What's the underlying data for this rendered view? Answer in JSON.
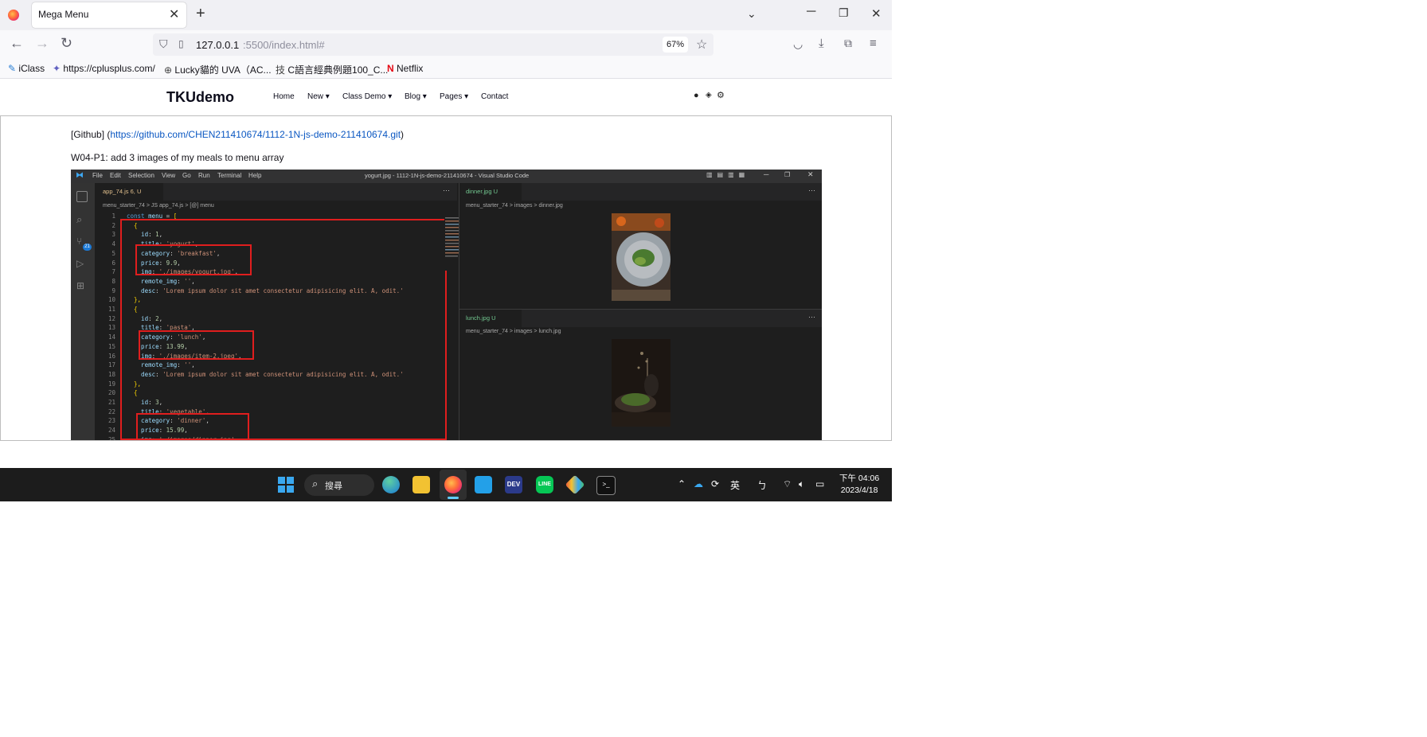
{
  "browser": {
    "tab_title": "Mega Menu",
    "tab_close": "✕",
    "new_tab": "+",
    "url_host": "127.0.0.1",
    "url_path": ":5500/index.html#",
    "zoom": "67%",
    "bookmarks": [
      "iClass",
      "https://cplusplus.com/",
      "Lucky貓的 UVA（AC...",
      "C語言經典例題100_C...",
      "Netflix"
    ]
  },
  "site": {
    "brand": "TKUdemo",
    "menu": [
      "Home",
      "New",
      "Class Demo",
      "Blog",
      "Pages",
      "Contact"
    ],
    "github_prefix": "[Github] (",
    "github_url": "https://github.com/CHEN211410674/1112-1N-js-demo-211410674.git",
    "github_suffix": ")",
    "assignment": "W04-P1: add 3 images of my meals to menu array"
  },
  "vscode": {
    "menus": [
      "File",
      "Edit",
      "Selection",
      "View",
      "Go",
      "Run",
      "Terminal",
      "Help"
    ],
    "window_title": "yogurt.jpg - 1112-1N-js-demo-211410674 - Visual Studio Code",
    "editor_tab": "app_74.js 6, U",
    "editor_breadcrumb": "menu_starter_74  >  JS app_74.js  >  [@] menu",
    "code_lines": [
      "const menu = [",
      "  {",
      "    id: 1,",
      "    title: 'yogurt',",
      "    category: 'breakfast',",
      "    price: 9.9,",
      "    img: './images/yogurt.jpg',",
      "    remote_img: '',",
      "    desc: 'Lorem ipsum dolor sit amet consectetur adipisicing elit. A, odit.'",
      "  },",
      "  {",
      "    id: 2,",
      "    title: 'pasta',",
      "    category: 'lunch',",
      "    price: 13.99,",
      "    img: './images/item-2.jpeg',",
      "    remote_img: '',",
      "    desc: 'Lorem ipsum dolor sit amet consectetur adipisicing elit. A, odit.'",
      "  },",
      "  {",
      "    id: 3,",
      "    title: 'vegetable',",
      "    category: 'dinner',",
      "    price: 15.99,",
      "    img: './images/dinner.jpg',"
    ],
    "pane_top_tab": "dinner.jpg  U",
    "pane_top_crumb": "menu_starter_74  >  images  >  dinner.jpg",
    "pane_bottom_tab": "lunch.jpg  U",
    "pane_bottom_crumb": "menu_starter_74  >  images  >  lunch.jpg"
  },
  "taskbar": {
    "search": "搜尋",
    "ime": "英",
    "time": "下午 04:06",
    "date": "2023/4/18"
  },
  "colors": {
    "accent_blue": "#0a57c2",
    "vscode_bg": "#1e1e1e",
    "highlight_red": "#e01e1e",
    "taskbar": "#1c1c1c"
  }
}
